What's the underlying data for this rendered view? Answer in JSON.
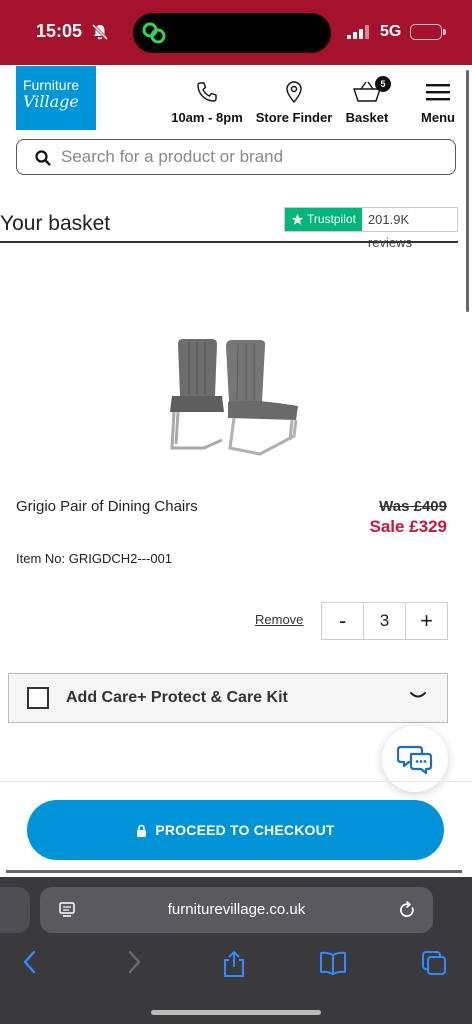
{
  "status_bar": {
    "time": "15:05",
    "network": "5G"
  },
  "header": {
    "logo_line1": "Furniture",
    "logo_line2": "Village",
    "phone_label": "10am - 8pm",
    "store_finder_label": "Store Finder",
    "basket_label": "Basket",
    "basket_count": "5",
    "menu_label": "Menu"
  },
  "search": {
    "placeholder": "Search for a product or brand"
  },
  "basket": {
    "title": "Your basket",
    "trustpilot_brand": "Trustpilot",
    "trustpilot_reviews": "201.9K reviews"
  },
  "product": {
    "name": "Grigio Pair of Dining Chairs",
    "was_price": "Was £409",
    "sale_price": "Sale £329",
    "item_no": "Item No: GRIGDCH2---001",
    "remove_label": "Remove",
    "quantity": "3",
    "decrement": "-",
    "increment": "+"
  },
  "care": {
    "label": "Add Care+ Protect & Care Kit"
  },
  "checkout": {
    "label": "PROCEED TO CHECKOUT"
  },
  "browser": {
    "url": "furniturevillage.co.uk"
  },
  "colors": {
    "status_bar": "#a4122c",
    "brand_blue": "#0095d9",
    "sale_red": "#c41839",
    "trustpilot_green": "#00b67a",
    "checkout_blue": "#0093d7"
  },
  "icons": [
    "bell-slash-icon",
    "phone-icon",
    "map-pin-icon",
    "basket-icon",
    "hamburger-menu-icon",
    "search-icon",
    "trustpilot-star-icon",
    "chevron-down-icon",
    "chat-icon",
    "lock-icon",
    "page-icon",
    "reload-icon",
    "back-icon",
    "forward-icon",
    "share-icon",
    "bookmarks-icon",
    "tabs-icon"
  ]
}
